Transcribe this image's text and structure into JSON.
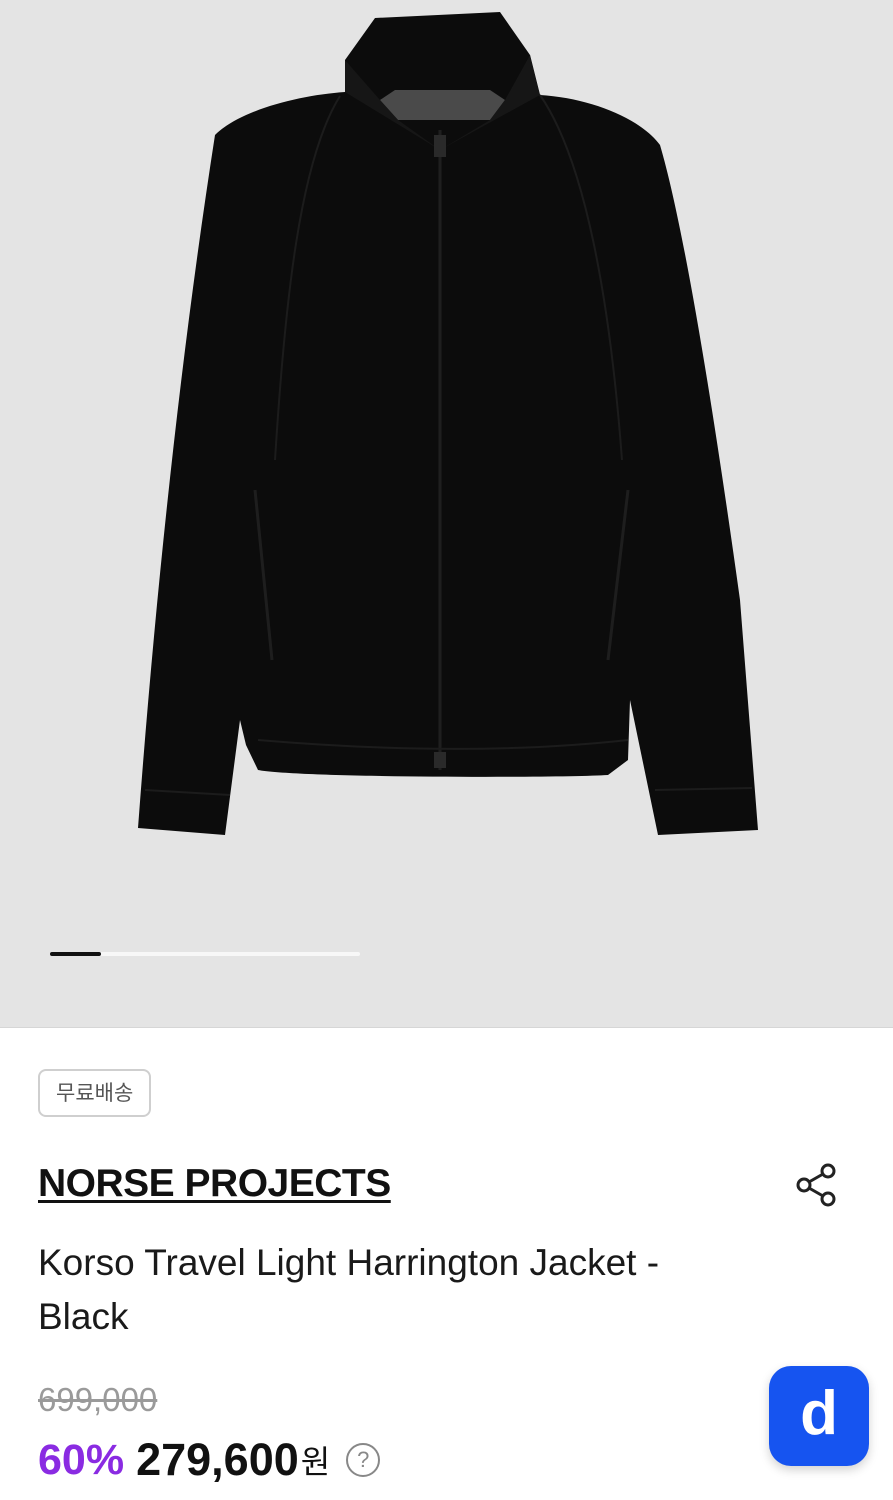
{
  "gallery": {
    "image_alt": "Black zip-up Harrington jacket with stand collar",
    "current_slide_fraction": 0.165
  },
  "badge": {
    "label": "무료배송"
  },
  "product": {
    "brand": "NORSE PROJECTS",
    "title": "Korso Travel Light Harrington Jacket - Black",
    "original_price": "699,000",
    "discount": "60%",
    "price": "279,600",
    "currency": "원"
  },
  "icons": {
    "share": "share-icon",
    "help": "question-icon",
    "fab": "app-logo-d"
  },
  "fab": {
    "label": "d"
  },
  "help": {
    "glyph": "?"
  },
  "colors": {
    "gallery_bg": "#e4e4e4",
    "discount": "#8a2be2",
    "fab": "#1654f0"
  }
}
